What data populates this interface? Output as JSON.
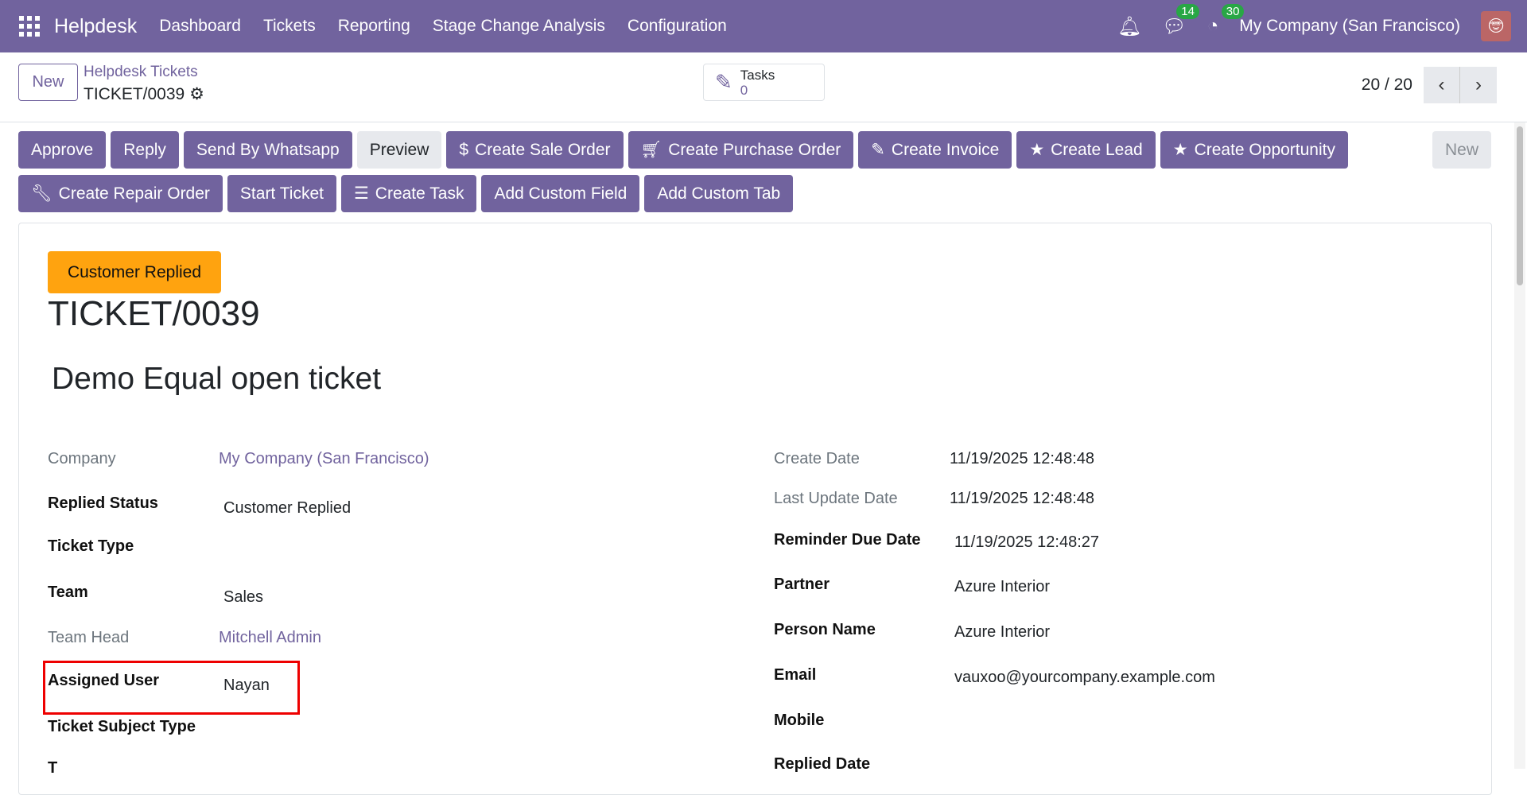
{
  "nav": {
    "app": "Helpdesk",
    "menu": [
      "Dashboard",
      "Tickets",
      "Reporting",
      "Stage Change Analysis",
      "Configuration"
    ],
    "messages_count": "14",
    "activities_count": "30",
    "company": "My Company (San Francisco)"
  },
  "control": {
    "new_label": "New",
    "breadcrumb_parent": "Helpdesk Tickets",
    "breadcrumb_current": "TICKET/0039",
    "tasks_label": "Tasks",
    "tasks_count": "0",
    "pager": "20 / 20"
  },
  "actions": {
    "row1": [
      "Approve",
      "Reply",
      "Send By Whatsapp",
      "Preview",
      "Create Sale Order",
      "Create Purchase Order",
      "Create Invoice",
      "Create Lead",
      "Create Opportunity"
    ],
    "row2": [
      "Create Repair Order",
      "Start Ticket",
      "Create Task",
      "Add Custom Field",
      "Add Custom Tab"
    ],
    "status_new": "New"
  },
  "form": {
    "stage": "Customer Replied",
    "number": "TICKET/0039",
    "name": "Demo Equal open ticket",
    "left": [
      {
        "label": "Company",
        "value": "My Company (San Francisco)"
      },
      {
        "label": "Replied Status",
        "value": "Customer Replied"
      },
      {
        "label": "Ticket Type",
        "value": ""
      },
      {
        "label": "Team",
        "value": "Sales"
      },
      {
        "label": "Team Head",
        "value": "Mitchell Admin"
      },
      {
        "label": "Assigned User",
        "value": "Nayan"
      },
      {
        "label": "Ticket Subject Type",
        "value": ""
      },
      {
        "label": "T",
        "value": ""
      }
    ],
    "right": [
      {
        "label": "Create Date",
        "value": "11/19/2025 12:48:48"
      },
      {
        "label": "Last Update Date",
        "value": "11/19/2025 12:48:48"
      },
      {
        "label": "Reminder Due Date",
        "value": "11/19/2025 12:48:27"
      },
      {
        "label": "Partner",
        "value": "Azure Interior"
      },
      {
        "label": "Person Name",
        "value": "Azure Interior"
      },
      {
        "label": "Email",
        "value": "vauxoo@yourcompany.example.com"
      },
      {
        "label": "Mobile",
        "value": ""
      },
      {
        "label": "Replied Date",
        "value": ""
      }
    ]
  }
}
